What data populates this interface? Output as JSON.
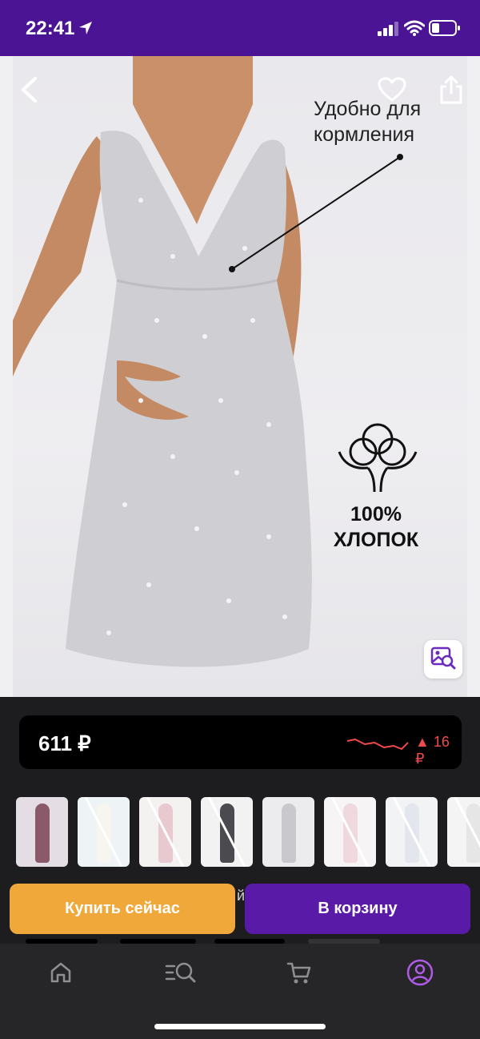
{
  "status": {
    "time": "22:41",
    "icons": [
      "location-arrow-icon",
      "signal-icon",
      "wifi-icon",
      "battery-icon"
    ]
  },
  "product_image": {
    "feature_note": "Удобно для кормления",
    "material_line1": "100%",
    "material_line2": "ХЛОПОК",
    "icons": [
      "back-chevron-icon",
      "heart-icon",
      "share-icon",
      "cotton-icon",
      "image-search-icon"
    ]
  },
  "price": {
    "value": "611 ₽",
    "change": "▲ 16 ₽",
    "change_color": "#ef4b4b"
  },
  "behind_text": "й",
  "actions": {
    "buy_now": "Купить сейчас",
    "add_to_cart": "В корзину"
  },
  "colors": {
    "status_bar": "#4a1494",
    "buy_now": "#f0a83a",
    "add_to_cart": "#5a1aa8",
    "active_tab": "#b05be8"
  },
  "tabs": [
    {
      "icon": "home-icon",
      "active": false
    },
    {
      "icon": "catalog-search-icon",
      "active": false
    },
    {
      "icon": "cart-icon",
      "active": false
    },
    {
      "icon": "profile-icon",
      "active": true
    }
  ]
}
